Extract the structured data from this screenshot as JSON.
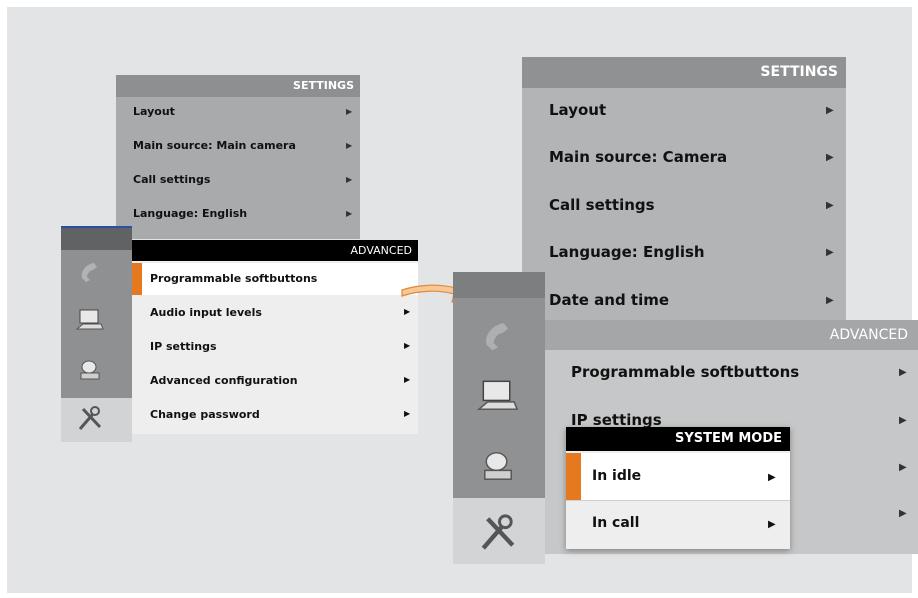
{
  "left_menu": {
    "settings_header": "SETTINGS",
    "settings_items": [
      {
        "label": "Layout"
      },
      {
        "label": "Main source: Main camera"
      },
      {
        "label": "Call settings"
      },
      {
        "label": "Language: English"
      }
    ],
    "advanced_header": "ADVANCED",
    "advanced_items": [
      {
        "label": "Programmable softbuttons",
        "selected": true
      },
      {
        "label": "Audio input levels"
      },
      {
        "label": "IP settings"
      },
      {
        "label": "Advanced configuration"
      },
      {
        "label": "Change password"
      }
    ],
    "sidebar_icons": [
      "phone-icon",
      "laptop-icon",
      "camera-icon",
      "tools-icon"
    ]
  },
  "right_menu": {
    "settings_header": "SETTINGS",
    "settings_items": [
      {
        "label": "Layout"
      },
      {
        "label": "Main source: Camera"
      },
      {
        "label": "Call settings"
      },
      {
        "label": "Language: English"
      },
      {
        "label": "Date and time"
      }
    ],
    "advanced_header": "ADVANCED",
    "advanced_items": [
      {
        "label": "Programmable softbuttons"
      },
      {
        "label": "IP settings"
      }
    ],
    "system_mode": {
      "header": "SYSTEM MODE",
      "items": [
        {
          "label": "In idle",
          "selected": true
        },
        {
          "label": "In call"
        }
      ]
    },
    "sidebar_icons": [
      "phone-icon",
      "laptop-icon",
      "camera-icon",
      "tools-icon"
    ]
  },
  "colors": {
    "accent": "#e67820",
    "header_dark": "#000000",
    "header_grey": "#8e8f90"
  }
}
